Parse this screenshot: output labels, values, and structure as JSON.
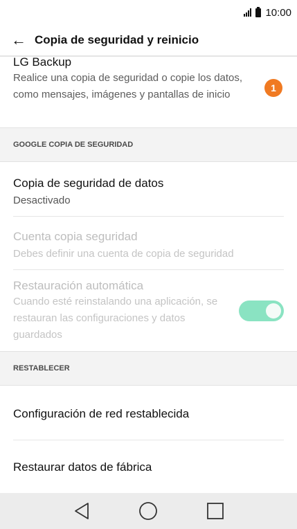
{
  "status_bar": {
    "time": "10:00"
  },
  "app_bar": {
    "title": "Copia de seguridad y reinicio"
  },
  "lg_backup": {
    "title": "LG Backup",
    "description": "Realice una copia de seguridad o copie los datos, como mensajes, imágenes y pantallas de inicio",
    "badge": "1",
    "badge_color": "#f07a22"
  },
  "google_section": {
    "header": "GOOGLE COPIA DE SEGURIDAD",
    "items": [
      {
        "title": "Copia de seguridad de datos",
        "subtitle": "Desactivado"
      },
      {
        "title": "Cuenta copia seguridad",
        "subtitle": "Debes definir una cuenta de copia de seguridad"
      },
      {
        "title": "Restauración automática",
        "subtitle": "Cuando esté reinstalando una aplicación, se restauran las configuraciones y datos guardados",
        "toggle_on": true
      }
    ]
  },
  "reset_section": {
    "header": "RESTABLECER",
    "items": [
      {
        "title": "Configuración de red restablecida"
      },
      {
        "title": "Restaurar datos de fábrica"
      }
    ]
  },
  "nav_bar": {
    "icons": [
      "back-icon",
      "home-icon",
      "recents-icon"
    ]
  },
  "colors": {
    "toggle_accent": "#8ae3c2",
    "badge": "#f07a22"
  }
}
